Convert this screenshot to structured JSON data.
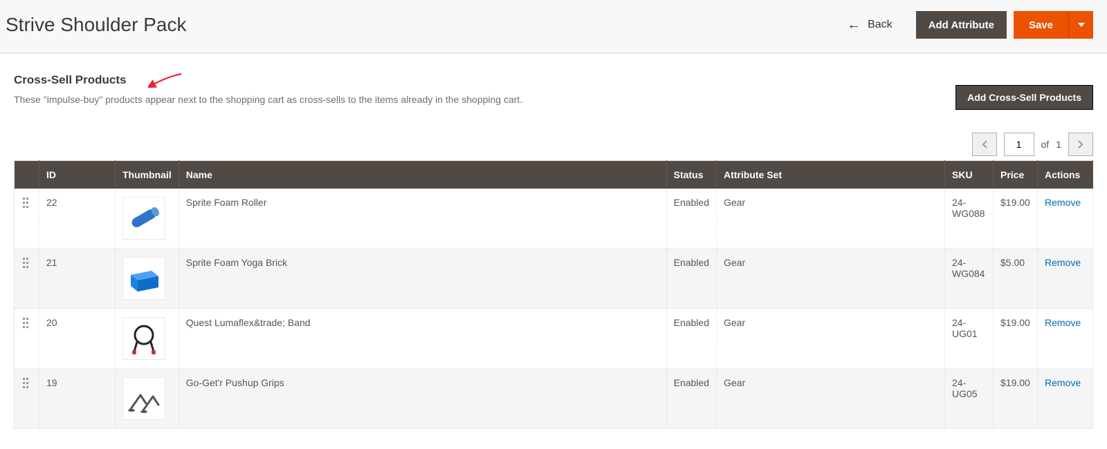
{
  "header": {
    "title": "Strive Shoulder Pack",
    "back_label": "Back",
    "add_attribute_label": "Add Attribute",
    "save_label": "Save"
  },
  "section": {
    "title": "Cross-Sell Products",
    "description": "These \"impulse-buy\" products appear next to the shopping cart as cross-sells to the items already in the shopping cart.",
    "add_button_label": "Add Cross-Sell Products"
  },
  "pager": {
    "current": "1",
    "of_label": "of",
    "total": "1"
  },
  "columns": {
    "id": "ID",
    "thumbnail": "Thumbnail",
    "name": "Name",
    "status": "Status",
    "attribute_set": "Attribute Set",
    "sku": "SKU",
    "price": "Price",
    "actions": "Actions"
  },
  "rows": [
    {
      "id": "22",
      "thumb_kind": "roller",
      "name": "Sprite Foam Roller",
      "status": "Enabled",
      "attribute_set": "Gear",
      "sku": "24-WG088",
      "price": "$19.00",
      "action": "Remove"
    },
    {
      "id": "21",
      "thumb_kind": "brick",
      "name": "Sprite Foam Yoga Brick",
      "status": "Enabled",
      "attribute_set": "Gear",
      "sku": "24-WG084",
      "price": "$5.00",
      "action": "Remove"
    },
    {
      "id": "20",
      "thumb_kind": "band",
      "name": "Quest Lumaflex&trade; Band",
      "status": "Enabled",
      "attribute_set": "Gear",
      "sku": "24-UG01",
      "price": "$19.00",
      "action": "Remove"
    },
    {
      "id": "19",
      "thumb_kind": "grips",
      "name": "Go-Get'r Pushup Grips",
      "status": "Enabled",
      "attribute_set": "Gear",
      "sku": "24-UG05",
      "price": "$19.00",
      "action": "Remove"
    }
  ]
}
